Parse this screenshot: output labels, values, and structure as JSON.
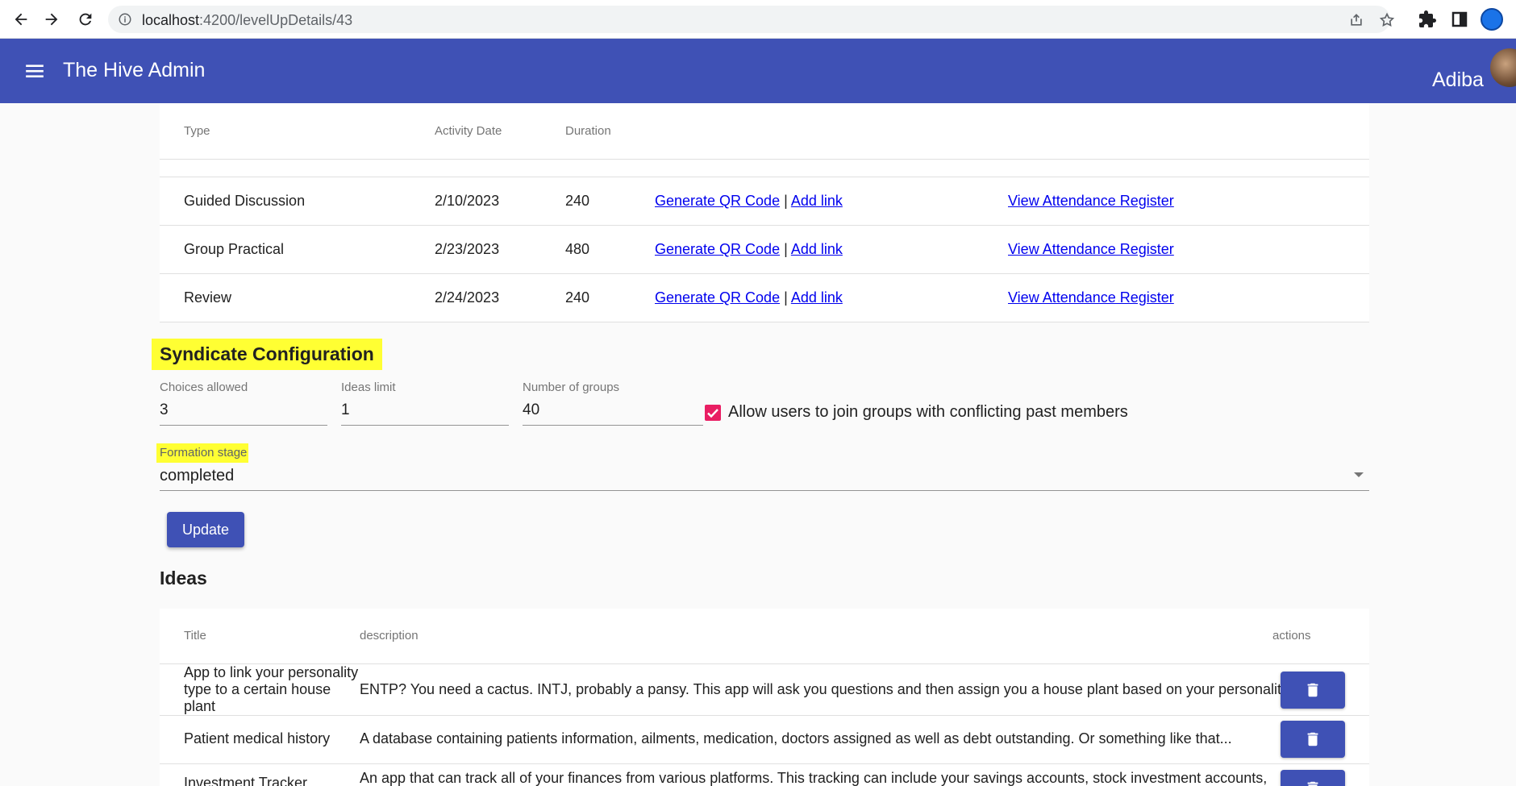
{
  "browser": {
    "url_host": "localhost",
    "url_path": ":4200/levelUpDetails/43"
  },
  "app_bar": {
    "title": "The Hive Admin",
    "user_name": "Adiba",
    "color": "#3f51b5"
  },
  "activities": {
    "headers": [
      "Type",
      "Activity Date",
      "Duration"
    ],
    "rows": [
      {
        "type": "Guided Discussion",
        "date": "2/10/2023",
        "duration": "240",
        "qr": "Generate QR Code",
        "sep": "|",
        "add": "Add link",
        "attendance": "View Attendance Register"
      },
      {
        "type": "Group Practical",
        "date": "2/23/2023",
        "duration": "480",
        "qr": "Generate QR Code",
        "sep": "|",
        "add": "Add link",
        "attendance": "View Attendance Register"
      },
      {
        "type": "Review",
        "date": "2/24/2023",
        "duration": "240",
        "qr": "Generate QR Code",
        "sep": "|",
        "add": "Add link",
        "attendance": "View Attendance Register"
      }
    ]
  },
  "syndicate": {
    "title": "Syndicate Configuration",
    "choices_label": "Choices allowed",
    "choices_value": "3",
    "ideas_limit_label": "Ideas limit",
    "ideas_limit_value": "1",
    "groups_label": "Number of groups",
    "groups_value": "40",
    "conflict_checkbox_label": "Allow users to join groups with conflicting past members",
    "conflict_checked": true,
    "formation_label": "Formation stage",
    "formation_value": "completed",
    "update_label": "Update",
    "highlight_color": "#ffff33",
    "checkbox_color": "#e91e63"
  },
  "ideas": {
    "title": "Ideas",
    "headers": {
      "title": "Title",
      "description": "description",
      "actions": "actions"
    },
    "rows": [
      {
        "title": "App to link your personality type to a certain house plant",
        "description": "ENTP? You need a cactus. INTJ, probably a pansy. This app will ask you questions and then assign you a house plant based on your personality."
      },
      {
        "title": "Patient medical history",
        "description": "A database containing patients information, ailments, medication, doctors assigned as well as debt outstanding. Or something like that..."
      },
      {
        "title": "Investment Tracker",
        "description": "An app that can track all of your finances from various platforms. This tracking can include your savings accounts, stock investment accounts,"
      }
    ],
    "delete_icon": "trash-icon"
  }
}
